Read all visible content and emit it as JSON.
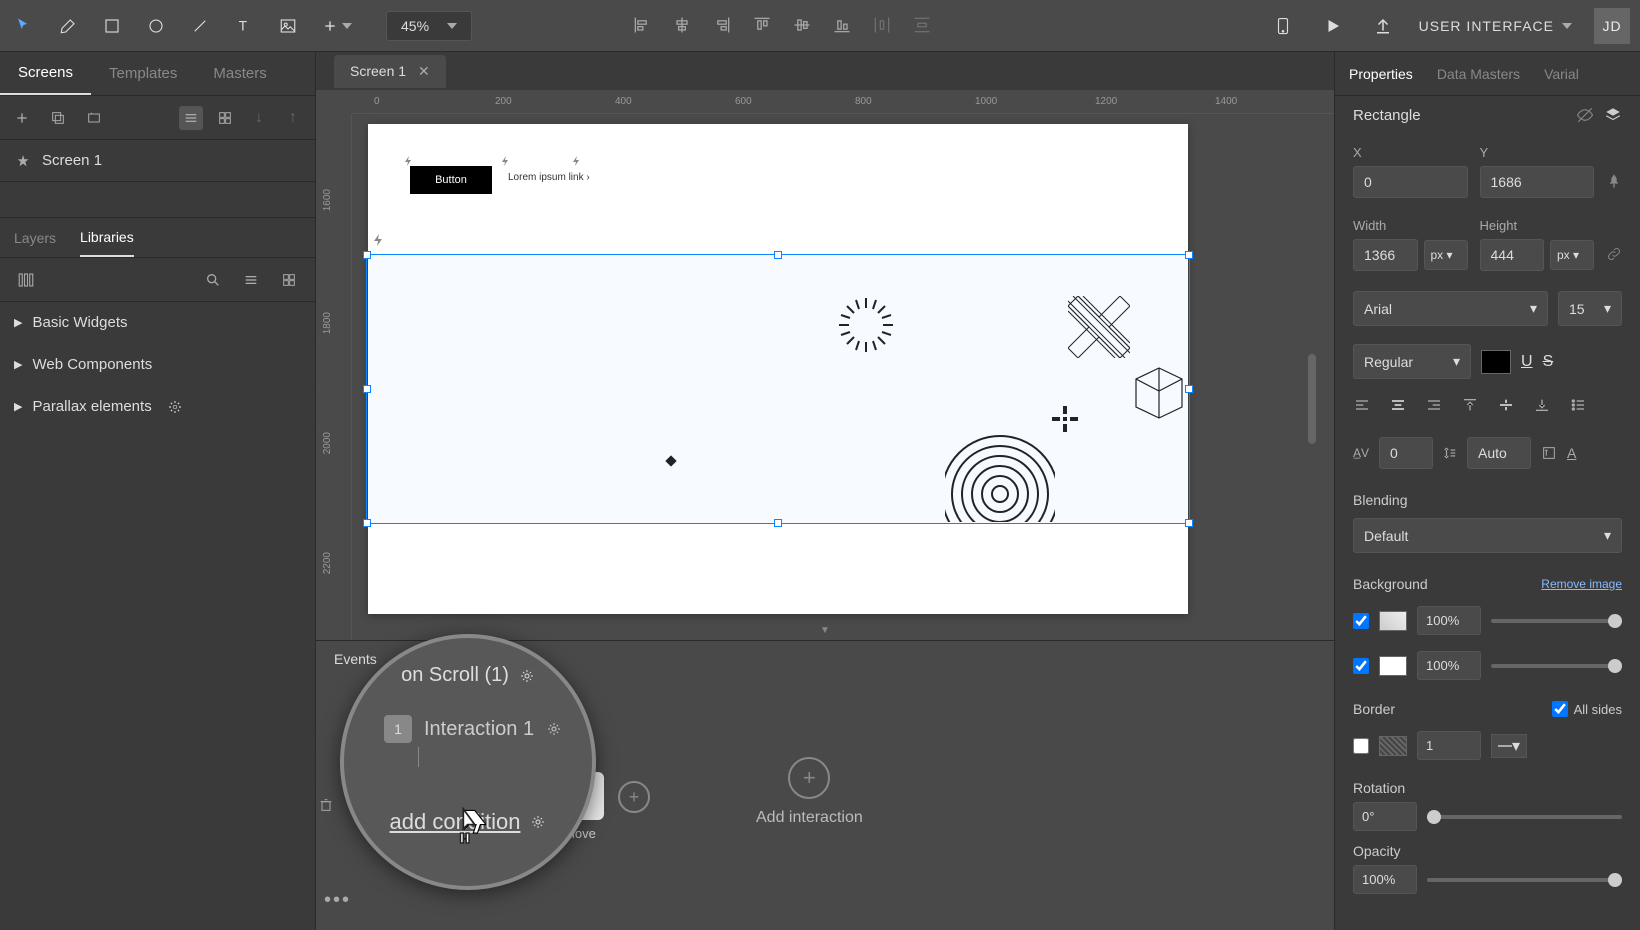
{
  "toolbar": {
    "zoom": "45%",
    "project_name": "USER INTERFACE",
    "user_initials": "JD"
  },
  "left": {
    "tabs": [
      "Screens",
      "Templates",
      "Masters"
    ],
    "active_screen": "Screen 1",
    "sub_tabs": [
      "Layers",
      "Libraries"
    ],
    "libraries": [
      "Basic Widgets",
      "Web Components",
      "Parallax elements"
    ]
  },
  "canvas": {
    "screen_tab": "Screen 1",
    "ruler_h": [
      "0",
      "200",
      "400",
      "600",
      "800",
      "1000",
      "1200",
      "1400"
    ],
    "ruler_v": [
      "1600",
      "1800",
      "2000",
      "2200"
    ],
    "button_label": "Button",
    "link_label": "Lorem ipsum link ›"
  },
  "events": {
    "tab": "Events",
    "add_interaction": "Add interaction",
    "move": "Move"
  },
  "magnifier": {
    "event": "on Scroll (1)",
    "interaction": "Interaction 1",
    "interaction_num": "1",
    "condition": "add condition"
  },
  "props": {
    "tabs": [
      "Properties",
      "Data Masters",
      "Varial"
    ],
    "element_type": "Rectangle",
    "x_label": "X",
    "x": "0",
    "y_label": "Y",
    "y": "1686",
    "w_label": "Width",
    "w": "1366",
    "w_unit": "px",
    "h_label": "Height",
    "h": "444",
    "h_unit": "px",
    "font": "Arial",
    "font_size": "15",
    "font_weight": "Regular",
    "letter_spacing": "0",
    "line_height": "Auto",
    "blend_label": "Blending",
    "blend": "Default",
    "bg_label": "Background",
    "remove_img": "Remove image",
    "bg_opacity1": "100%",
    "bg_opacity2": "100%",
    "border_label": "Border",
    "all_sides": "All sides",
    "border_w": "1",
    "rotation_label": "Rotation",
    "rotation": "0°",
    "opacity_label": "Opacity",
    "opacity": "100%"
  }
}
